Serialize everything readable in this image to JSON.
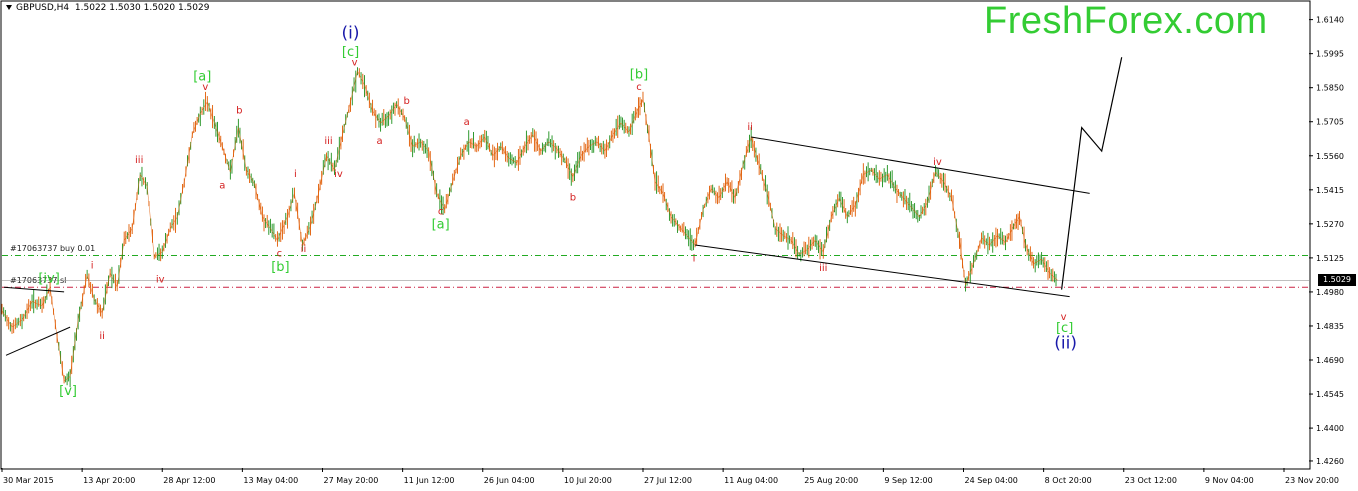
{
  "header": {
    "symbol": "GBPUSD,H4",
    "ohlc": "1.5022 1.5030 1.5020 1.5029"
  },
  "brand": {
    "text": "FreshForex.com",
    "color": "#33cc33"
  },
  "orders": {
    "buy_label": "#17063737 buy 0.01",
    "sl_label": "#17063737 sl",
    "buy_price": 1.5135,
    "sl_price": 1.5
  },
  "current_price": {
    "value": "1.5029",
    "level": 1.5029
  },
  "colors": {
    "candle": "#e05a00",
    "candle_alt": "#1a8f1a",
    "wave_red": "#d42020",
    "wave_green": "#33cc33",
    "wave_blue": "#1a1aaa",
    "buy_line": "#22aa22",
    "sl_line": "#cc2244"
  },
  "chart_data": {
    "type": "line",
    "title": "GBPUSD,H4",
    "ylim": [
      1.423,
      1.6215
    ],
    "y_ticks": [
      "1.6140",
      "1.5995",
      "1.5850",
      "1.5705",
      "1.5560",
      "1.5415",
      "1.5270",
      "1.5125",
      "1.4980",
      "1.4835",
      "1.4690",
      "1.4545",
      "1.4400",
      "1.4260"
    ],
    "x_ticks": [
      "30 Mar 2015",
      "13 Apr 20:00",
      "28 Apr 12:00",
      "13 May 04:00",
      "27 May 20:00",
      "11 Jun 12:00",
      "26 Jun 04:00",
      "10 Jul 20:00",
      "27 Jul 12:00",
      "11 Aug 04:00",
      "25 Aug 20:00",
      "9 Sep 12:00",
      "24 Sep 04:00",
      "8 Oct 20:00",
      "23 Oct 12:00",
      "9 Nov 04:00",
      "23 Nov 20:00"
    ],
    "x_range": [
      0,
      1305
    ],
    "series": [
      {
        "points": [
          [
            0,
            1.49
          ],
          [
            10,
            1.483
          ],
          [
            20,
            1.486
          ],
          [
            30,
            1.494
          ],
          [
            40,
            1.492
          ],
          [
            48,
            1.5
          ],
          [
            55,
            1.479
          ],
          [
            62,
            1.46
          ],
          [
            68,
            1.462
          ],
          [
            76,
            1.486
          ],
          [
            85,
            1.505
          ],
          [
            92,
            1.495
          ],
          [
            100,
            1.489
          ],
          [
            108,
            1.506
          ],
          [
            115,
            1.5
          ],
          [
            122,
            1.52
          ],
          [
            130,
            1.525
          ],
          [
            138,
            1.548
          ],
          [
            145,
            1.543
          ],
          [
            152,
            1.513
          ],
          [
            160,
            1.515
          ],
          [
            168,
            1.525
          ],
          [
            175,
            1.53
          ],
          [
            182,
            1.545
          ],
          [
            190,
            1.565
          ],
          [
            198,
            1.574
          ],
          [
            205,
            1.579
          ],
          [
            212,
            1.57
          ],
          [
            220,
            1.56
          ],
          [
            228,
            1.549
          ],
          [
            236,
            1.568
          ],
          [
            244,
            1.55
          ],
          [
            252,
            1.544
          ],
          [
            260,
            1.53
          ],
          [
            268,
            1.525
          ],
          [
            275,
            1.52
          ],
          [
            285,
            1.53
          ],
          [
            292,
            1.54
          ],
          [
            300,
            1.518
          ],
          [
            308,
            1.526
          ],
          [
            316,
            1.54
          ],
          [
            324,
            1.556
          ],
          [
            332,
            1.55
          ],
          [
            340,
            1.565
          ],
          [
            348,
            1.579
          ],
          [
            355,
            1.592
          ],
          [
            362,
            1.586
          ],
          [
            370,
            1.575
          ],
          [
            378,
            1.57
          ],
          [
            386,
            1.573
          ],
          [
            394,
            1.578
          ],
          [
            402,
            1.572
          ],
          [
            410,
            1.56
          ],
          [
            418,
            1.562
          ],
          [
            426,
            1.558
          ],
          [
            434,
            1.54
          ],
          [
            442,
            1.533
          ],
          [
            450,
            1.545
          ],
          [
            458,
            1.556
          ],
          [
            466,
            1.562
          ],
          [
            474,
            1.56
          ],
          [
            482,
            1.564
          ],
          [
            490,
            1.556
          ],
          [
            498,
            1.56
          ],
          [
            506,
            1.555
          ],
          [
            514,
            1.553
          ],
          [
            522,
            1.56
          ],
          [
            530,
            1.565
          ],
          [
            538,
            1.558
          ],
          [
            546,
            1.562
          ],
          [
            554,
            1.559
          ],
          [
            562,
            1.554
          ],
          [
            570,
            1.547
          ],
          [
            578,
            1.556
          ],
          [
            586,
            1.56
          ],
          [
            594,
            1.562
          ],
          [
            602,
            1.558
          ],
          [
            610,
            1.565
          ],
          [
            618,
            1.57
          ],
          [
            626,
            1.566
          ],
          [
            634,
            1.575
          ],
          [
            640,
            1.58
          ],
          [
            646,
            1.564
          ],
          [
            652,
            1.545
          ],
          [
            660,
            1.54
          ],
          [
            668,
            1.53
          ],
          [
            676,
            1.526
          ],
          [
            684,
            1.522
          ],
          [
            692,
            1.518
          ],
          [
            700,
            1.533
          ],
          [
            708,
            1.542
          ],
          [
            716,
            1.538
          ],
          [
            724,
            1.545
          ],
          [
            732,
            1.538
          ],
          [
            740,
            1.552
          ],
          [
            748,
            1.564
          ],
          [
            756,
            1.552
          ],
          [
            764,
            1.54
          ],
          [
            772,
            1.525
          ],
          [
            780,
            1.522
          ],
          [
            788,
            1.52
          ],
          [
            796,
            1.514
          ],
          [
            804,
            1.516
          ],
          [
            812,
            1.52
          ],
          [
            820,
            1.515
          ],
          [
            828,
            1.53
          ],
          [
            836,
            1.538
          ],
          [
            844,
            1.53
          ],
          [
            852,
            1.535
          ],
          [
            860,
            1.548
          ],
          [
            868,
            1.55
          ],
          [
            876,
            1.546
          ],
          [
            884,
            1.548
          ],
          [
            892,
            1.542
          ],
          [
            900,
            1.538
          ],
          [
            908,
            1.534
          ],
          [
            916,
            1.53
          ],
          [
            924,
            1.536
          ],
          [
            932,
            1.549
          ],
          [
            940,
            1.545
          ],
          [
            948,
            1.538
          ],
          [
            956,
            1.52
          ],
          [
            962,
            1.501
          ],
          [
            970,
            1.51
          ],
          [
            978,
            1.521
          ],
          [
            986,
            1.518
          ],
          [
            994,
            1.522
          ],
          [
            1002,
            1.519
          ],
          [
            1010,
            1.526
          ],
          [
            1016,
            1.53
          ],
          [
            1022,
            1.518
          ],
          [
            1030,
            1.51
          ],
          [
            1038,
            1.512
          ],
          [
            1046,
            1.506
          ],
          [
            1054,
            1.5029
          ]
        ]
      }
    ],
    "projection": [
      [
        1058,
        1.499
      ],
      [
        1078,
        1.568
      ],
      [
        1098,
        1.558
      ],
      [
        1118,
        1.598
      ]
    ],
    "channel": [
      [
        [
          748,
          1.564
        ],
        [
          1086,
          1.54
        ]
      ],
      [
        [
          692,
          1.518
        ],
        [
          1066,
          1.496
        ]
      ]
    ],
    "small_channel": [
      [
        [
          2,
          1.5
        ],
        [
          62,
          1.498
        ]
      ],
      [
        [
          4,
          1.471
        ],
        [
          68,
          1.483
        ]
      ]
    ],
    "wave_labels": [
      {
        "text": "(i)",
        "x": 348,
        "y": 1.606,
        "color": "blue",
        "size": 17
      },
      {
        "text": "[c]",
        "x": 348,
        "y": 1.5985,
        "color": "green",
        "size": 13
      },
      {
        "text": "v",
        "x": 352,
        "y": 1.5945,
        "color": "red",
        "size": 10
      },
      {
        "text": "[a]",
        "x": 200,
        "y": 1.588,
        "color": "green",
        "size": 13
      },
      {
        "text": "v",
        "x": 203,
        "y": 1.584,
        "color": "red",
        "size": 10
      },
      {
        "text": "b",
        "x": 237,
        "y": 1.574,
        "color": "red",
        "size": 10
      },
      {
        "text": "a",
        "x": 220,
        "y": 1.542,
        "color": "red",
        "size": 10
      },
      {
        "text": "iii",
        "x": 137,
        "y": 1.553,
        "color": "red",
        "size": 10
      },
      {
        "text": "i",
        "x": 90,
        "y": 1.508,
        "color": "red",
        "size": 10
      },
      {
        "text": "ii",
        "x": 100,
        "y": 1.478,
        "color": "red",
        "size": 10
      },
      {
        "text": "iv",
        "x": 158,
        "y": 1.502,
        "color": "red",
        "size": 10
      },
      {
        "text": "[iv]",
        "x": 47,
        "y": 1.502,
        "color": "green",
        "size": 13
      },
      {
        "text": "[v]",
        "x": 66,
        "y": 1.454,
        "color": "green",
        "size": 13
      },
      {
        "text": "c",
        "x": 277,
        "y": 1.513,
        "color": "red",
        "size": 10
      },
      {
        "text": "[b]",
        "x": 278,
        "y": 1.507,
        "color": "green",
        "size": 13
      },
      {
        "text": "i",
        "x": 293,
        "y": 1.547,
        "color": "red",
        "size": 10
      },
      {
        "text": "ii",
        "x": 301,
        "y": 1.515,
        "color": "red",
        "size": 10
      },
      {
        "text": "iii",
        "x": 326,
        "y": 1.561,
        "color": "red",
        "size": 10
      },
      {
        "text": "iv",
        "x": 336,
        "y": 1.547,
        "color": "red",
        "size": 10
      },
      {
        "text": "b",
        "x": 404,
        "y": 1.578,
        "color": "red",
        "size": 10
      },
      {
        "text": "a",
        "x": 377,
        "y": 1.561,
        "color": "red",
        "size": 10
      },
      {
        "text": "a",
        "x": 464,
        "y": 1.569,
        "color": "red",
        "size": 10
      },
      {
        "text": "c",
        "x": 438,
        "y": 1.531,
        "color": "red",
        "size": 10
      },
      {
        "text": "[a]",
        "x": 438,
        "y": 1.525,
        "color": "green",
        "size": 13
      },
      {
        "text": "b",
        "x": 570,
        "y": 1.537,
        "color": "red",
        "size": 10
      },
      {
        "text": "[b]",
        "x": 636,
        "y": 1.589,
        "color": "green",
        "size": 13
      },
      {
        "text": "c",
        "x": 636,
        "y": 1.584,
        "color": "red",
        "size": 10
      },
      {
        "text": "ii",
        "x": 747,
        "y": 1.567,
        "color": "red",
        "size": 10
      },
      {
        "text": "i",
        "x": 691,
        "y": 1.511,
        "color": "red",
        "size": 10
      },
      {
        "text": "iii",
        "x": 820,
        "y": 1.507,
        "color": "red",
        "size": 10
      },
      {
        "text": "iv",
        "x": 934,
        "y": 1.552,
        "color": "red",
        "size": 10
      },
      {
        "text": "v",
        "x": 1060,
        "y": 1.486,
        "color": "red",
        "size": 10
      },
      {
        "text": "[c]",
        "x": 1061,
        "y": 1.481,
        "color": "green",
        "size": 13
      },
      {
        "text": "(ii)",
        "x": 1062,
        "y": 1.474,
        "color": "blue",
        "size": 17
      }
    ]
  }
}
